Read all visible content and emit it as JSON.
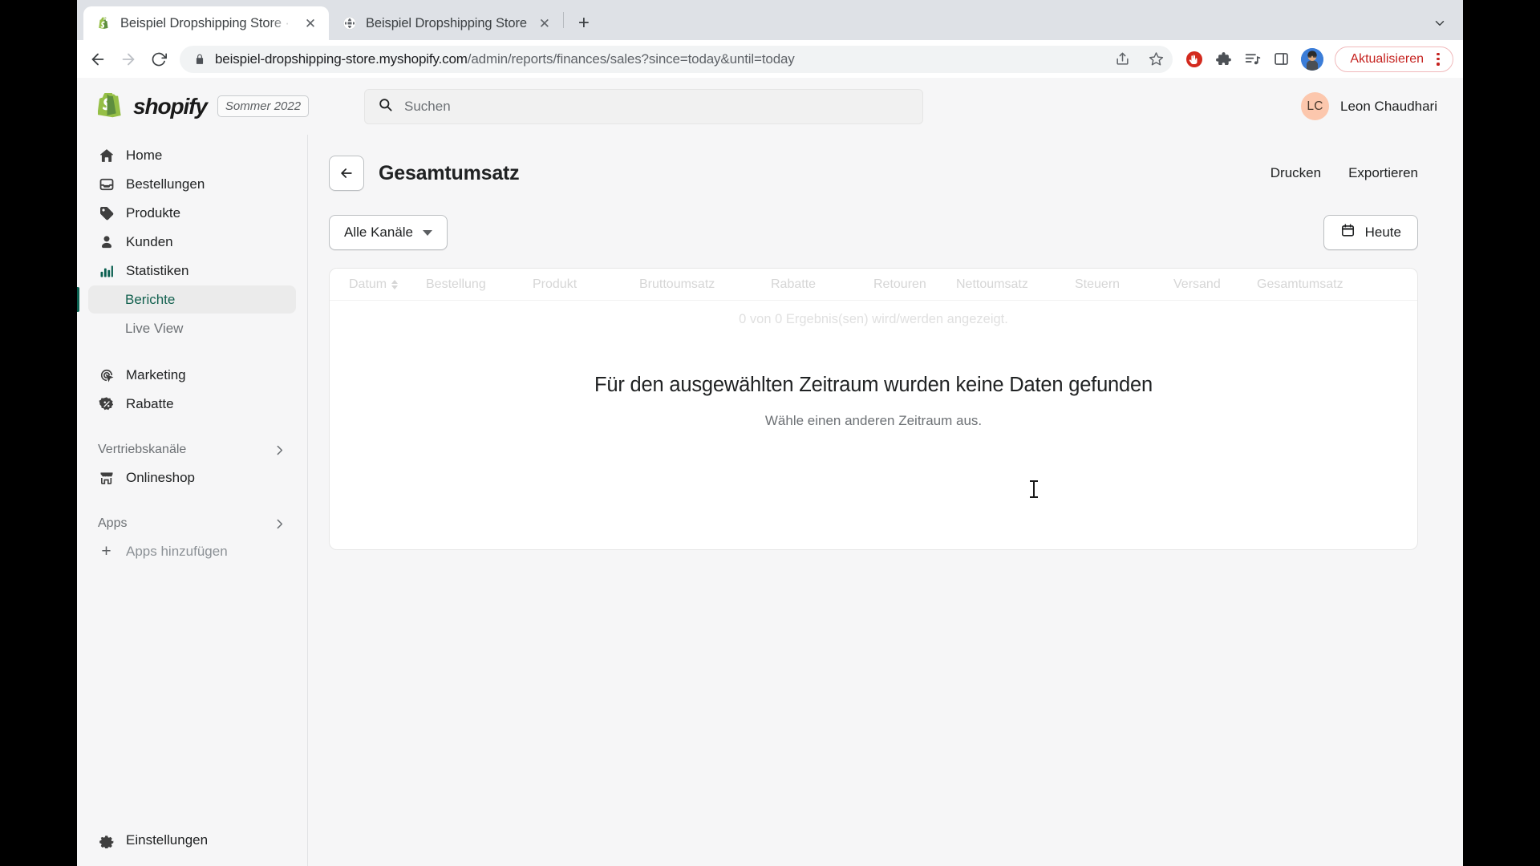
{
  "browser": {
    "tabs": [
      {
        "title": "Beispiel Dropshipping Store · F",
        "favicon": "shopify-favicon",
        "active": true
      },
      {
        "title": "Beispiel Dropshipping Store",
        "favicon": "globe-favicon",
        "active": false
      }
    ],
    "new_tab_label": "+",
    "close_label": "✕",
    "nav": {
      "back": "back-arrow",
      "forward": "forward-arrow",
      "reload": "reload-arrow"
    },
    "url_host": "beispiel-dropshipping-store.myshopify.com",
    "url_path": "/admin/reports/finances/sales?since=today&until=today",
    "toolbar_icons": [
      "share-icon",
      "bookmark-star-icon",
      "adblock-icon",
      "extensions-puzzle-icon",
      "reading-list-icon",
      "side-panel-icon"
    ],
    "update_button": "Aktualisieren",
    "profile_avatar": "browser-profile-avatar"
  },
  "topbar": {
    "brand_word": "shopify",
    "season_badge": "Sommer 2022",
    "search_placeholder": "Suchen",
    "user_initials": "LC",
    "user_name": "Leon Chaudhari"
  },
  "sidebar": {
    "items": [
      {
        "label": "Home",
        "icon": "home-icon"
      },
      {
        "label": "Bestellungen",
        "icon": "orders-inbox-icon"
      },
      {
        "label": "Produkte",
        "icon": "product-tag-icon"
      },
      {
        "label": "Kunden",
        "icon": "customer-person-icon"
      },
      {
        "label": "Statistiken",
        "icon": "analytics-bars-icon"
      }
    ],
    "sub_items": [
      {
        "label": "Berichte",
        "active": true
      },
      {
        "label": "Live View",
        "active": false
      }
    ],
    "items2": [
      {
        "label": "Marketing",
        "icon": "marketing-target-icon"
      },
      {
        "label": "Rabatte",
        "icon": "discount-badge-icon"
      }
    ],
    "sections": [
      {
        "label": "Vertriebskanäle",
        "chevron": "chevron-right-icon"
      },
      {
        "label": "Apps",
        "chevron": "chevron-right-icon"
      }
    ],
    "channel_item": {
      "label": "Onlineshop",
      "icon": "storefront-icon"
    },
    "add_apps": {
      "label": "Apps hinzufügen",
      "icon": "plus-icon"
    },
    "settings": {
      "label": "Einstellungen",
      "icon": "gear-icon"
    }
  },
  "main": {
    "back_icon": "back-arrow-icon",
    "page_title": "Gesamtumsatz",
    "actions": [
      {
        "label": "Drucken"
      },
      {
        "label": "Exportieren"
      }
    ],
    "channel_filter": "Alle Kanäle",
    "date_filter": {
      "label": "Heute",
      "icon": "calendar-icon"
    },
    "table_headers": [
      {
        "label": "Datum",
        "sortable": true
      },
      {
        "label": "Bestellung",
        "sortable": false
      },
      {
        "label": "Produkt",
        "sortable": false
      },
      {
        "label": "Bruttoumsatz",
        "sortable": false
      },
      {
        "label": "Rabatte",
        "sortable": false
      },
      {
        "label": "Retouren",
        "sortable": false
      },
      {
        "label": "Nettoumsatz",
        "sortable": false
      },
      {
        "label": "Steuern",
        "sortable": false
      },
      {
        "label": "Versand",
        "sortable": false
      },
      {
        "label": "Gesamtumsatz",
        "sortable": false
      }
    ],
    "results_line": "0 von 0 Ergebnis(sen) wird/werden angezeigt.",
    "empty_title": "Für den ausgewählten Zeitraum wurden keine Daten gefunden",
    "empty_subtitle": "Wähle einen anderen Zeitraum aus."
  },
  "colors": {
    "brand_green": "#0b6050",
    "active_text": "#13614f",
    "avatar_bg": "#fcc7ad",
    "update_red": "#c5221f",
    "page_bg": "#f6f6f7"
  }
}
